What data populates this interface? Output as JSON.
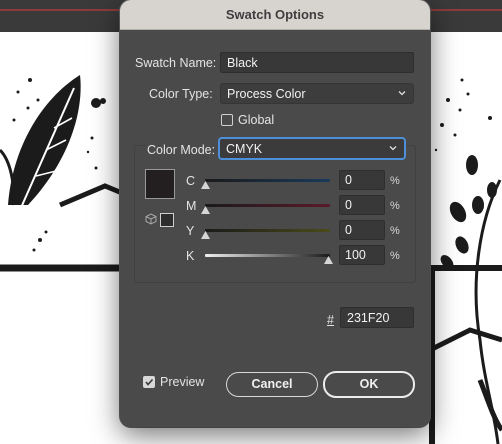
{
  "dialog": {
    "title": "Swatch Options",
    "swatch_name_label": "Swatch Name:",
    "swatch_name_value": "Black",
    "color_type_label": "Color Type:",
    "color_type_value": "Process Color",
    "global_label": "Global",
    "global_checked": false,
    "color_mode_label": "Color Mode:",
    "color_mode_value": "CMYK",
    "swatch_color": "#231F20",
    "channels": [
      {
        "label": "C",
        "value": "0",
        "unit": "%",
        "level": 0
      },
      {
        "label": "M",
        "value": "0",
        "unit": "%",
        "level": 0
      },
      {
        "label": "Y",
        "value": "0",
        "unit": "%",
        "level": 0
      },
      {
        "label": "K",
        "value": "100",
        "unit": "%",
        "level": 1
      }
    ],
    "hex_label": "#",
    "hex_value": "231F20",
    "preview_label": "Preview",
    "preview_checked": true,
    "cancel_label": "Cancel",
    "ok_label": "OK"
  },
  "colors": {
    "dialog_bg": "#4a4a4a",
    "titlebar_bg": "#d7d3cf",
    "focus_ring": "#4d8fd8",
    "canvas_guide": "#e23b3b"
  }
}
